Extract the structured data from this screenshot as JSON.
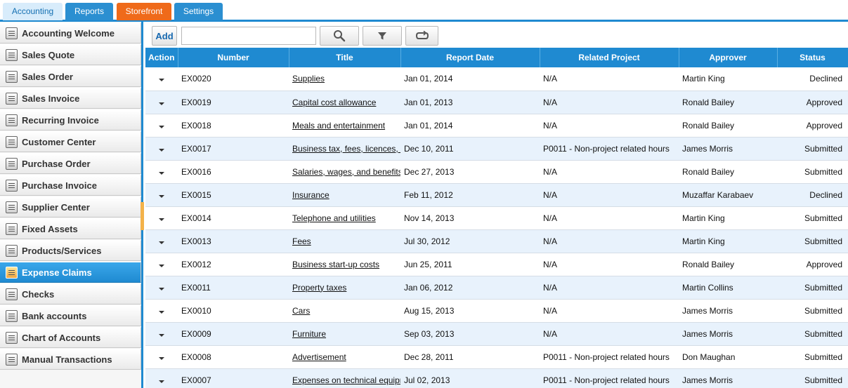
{
  "tabs": [
    {
      "label": "Accounting",
      "active": true
    },
    {
      "label": "Reports",
      "active": false
    },
    {
      "label": "Storefront",
      "active": false
    },
    {
      "label": "Settings",
      "active": false
    }
  ],
  "sidebar": {
    "items": [
      {
        "label": "Accounting Welcome",
        "icon": "calculator-icon"
      },
      {
        "label": "Sales Quote",
        "icon": "quote-icon"
      },
      {
        "label": "Sales Order",
        "icon": "order-icon"
      },
      {
        "label": "Sales Invoice",
        "icon": "invoice-icon"
      },
      {
        "label": "Recurring Invoice",
        "icon": "recurring-invoice-icon"
      },
      {
        "label": "Customer Center",
        "icon": "customer-icon"
      },
      {
        "label": "Purchase Order",
        "icon": "truck-icon"
      },
      {
        "label": "Purchase Invoice",
        "icon": "truck-invoice-icon"
      },
      {
        "label": "Supplier Center",
        "icon": "supplier-icon"
      },
      {
        "label": "Fixed Assets",
        "icon": "fixed-assets-icon"
      },
      {
        "label": "Products/Services",
        "icon": "products-icon"
      },
      {
        "label": "Expense Claims",
        "icon": "expense-icon",
        "active": true
      },
      {
        "label": "Checks",
        "icon": "check-icon"
      },
      {
        "label": "Bank accounts",
        "icon": "bank-icon"
      },
      {
        "label": "Chart of Accounts",
        "icon": "chart-accounts-icon"
      },
      {
        "label": "Manual Transactions",
        "icon": "manual-transactions-icon"
      }
    ]
  },
  "toolbar": {
    "add_label": "Add",
    "search_value": "",
    "search_placeholder": ""
  },
  "table": {
    "headers": {
      "action": "Action",
      "number": "Number",
      "title": "Title",
      "report_date": "Report Date",
      "related_project": "Related Project",
      "approver": "Approver",
      "status": "Status"
    },
    "rows": [
      {
        "number": "EX0020",
        "title": "Supplies",
        "date": "Jan 01, 2014",
        "project": "N/A",
        "approver": "Martin King",
        "status": "Declined"
      },
      {
        "number": "EX0019",
        "title": "Capital cost allowance",
        "date": "Jan 01, 2013",
        "project": "N/A",
        "approver": "Ronald Bailey",
        "status": "Approved"
      },
      {
        "number": "EX0018",
        "title": "Meals and entertainment",
        "date": "Jan 01, 2014",
        "project": "N/A",
        "approver": "Ronald Bailey",
        "status": "Approved"
      },
      {
        "number": "EX0017",
        "title": "Business tax, fees, licences, d",
        "date": "Dec 10, 2011",
        "project": "P0011 - Non-project related hours",
        "approver": "James Morris",
        "status": "Submitted"
      },
      {
        "number": "EX0016",
        "title": "Salaries, wages, and benefits",
        "date": "Dec 27, 2013",
        "project": "N/A",
        "approver": "Ronald Bailey",
        "status": "Submitted"
      },
      {
        "number": "EX0015",
        "title": "Insurance",
        "date": "Feb 11, 2012",
        "project": "N/A",
        "approver": "Muzaffar Karabaev",
        "status": "Declined"
      },
      {
        "number": "EX0014",
        "title": "Telephone and utilities",
        "date": "Nov 14, 2013",
        "project": "N/A",
        "approver": "Martin King",
        "status": "Submitted"
      },
      {
        "number": "EX0013",
        "title": "Fees",
        "date": "Jul 30, 2012",
        "project": "N/A",
        "approver": "Martin King",
        "status": "Submitted"
      },
      {
        "number": "EX0012",
        "title": "Business start-up costs",
        "date": "Jun 25, 2011",
        "project": "N/A",
        "approver": "Ronald Bailey",
        "status": "Approved"
      },
      {
        "number": "EX0011",
        "title": "Property taxes",
        "date": "Jan 06, 2012",
        "project": "N/A",
        "approver": "Martin Collins",
        "status": "Submitted"
      },
      {
        "number": "EX0010",
        "title": "Cars",
        "date": "Aug 15, 2013",
        "project": "N/A",
        "approver": "James Morris",
        "status": "Submitted"
      },
      {
        "number": "EX0009",
        "title": "Furniture",
        "date": "Sep 03, 2013",
        "project": "N/A",
        "approver": "James Morris",
        "status": "Submitted"
      },
      {
        "number": "EX0008",
        "title": "Advertisement",
        "date": "Dec 28, 2011",
        "project": "P0011 - Non-project related hours",
        "approver": "Don Maughan",
        "status": "Submitted"
      },
      {
        "number": "EX0007",
        "title": "Expenses on technical equipme",
        "date": "Jul 02, 2013",
        "project": "P0011 - Non-project related hours",
        "approver": "James Morris",
        "status": "Submitted"
      }
    ]
  },
  "colors": {
    "accent": "#1f8ad1",
    "storefront_tab": "#ef6a1a",
    "row_alt": "#e8f2fc"
  }
}
